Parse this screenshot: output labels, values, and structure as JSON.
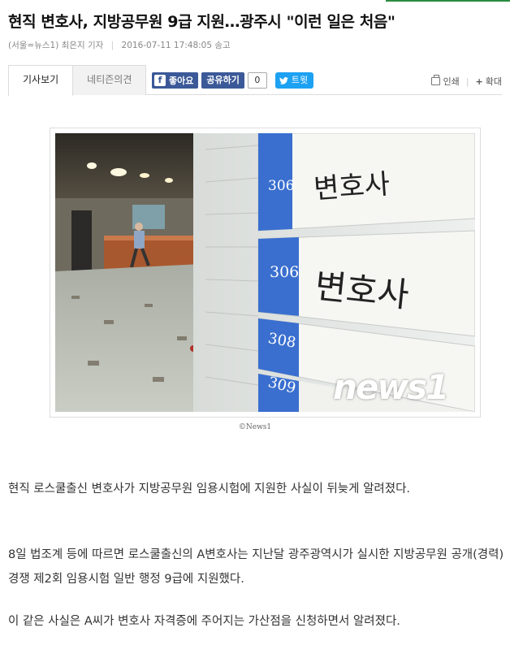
{
  "article": {
    "title": "현직 변호사, 지방공무원 9급 지원…광주시 \"이런 일은 처음\"",
    "source": "(서울=뉴스1) 최은지 기자",
    "datetime": "2016-07-11 17:48:05 송고"
  },
  "tabs": [
    {
      "label": "기사보기",
      "active": true
    },
    {
      "label": "네티즌의견",
      "active": false
    }
  ],
  "share": {
    "facebook_label": "좋아요",
    "share_label": "공유하기",
    "share_count": "0",
    "twitter_label": "트윗"
  },
  "tools": {
    "print_label": "인쇄",
    "zoom_label": "확대"
  },
  "photo": {
    "plates": [
      "306",
      "306",
      "308",
      "309"
    ],
    "plate_text": "변호사",
    "watermark": "news1",
    "caption": "©News1"
  },
  "body": [
    "현직 로스쿨출신 변호사가 지방공무원 임용시험에 지원한 사실이 뒤늦게 알려졌다.",
    "8일 법조계 등에 따르면 로스쿨출신의 A변호사는 지난달 광주광역시가 실시한 지방공무원 공개(경력)경쟁 제2회 임용시험 일반 행정 9급에 지원했다.",
    "이 같은 사실은 A씨가 변호사 자격증에 주어지는 가산점을 신청하면서 알려졌다."
  ],
  "colors": {
    "facebook": "#3b5998",
    "twitter": "#1da1f2",
    "top_accent": "#2a8b3f"
  }
}
